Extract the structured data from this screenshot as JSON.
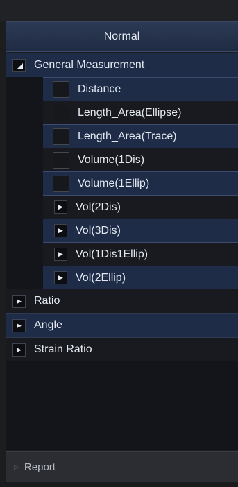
{
  "header": {
    "title": "Normal"
  },
  "tree": {
    "general": {
      "label": "General Measurement"
    },
    "items": [
      {
        "label": "Distance"
      },
      {
        "label": "Length_Area(Ellipse)"
      },
      {
        "label": "Length_Area(Trace)"
      },
      {
        "label": "Volume(1Dis)"
      },
      {
        "label": "Volume(1Ellip)"
      }
    ],
    "groups": [
      {
        "label": "Vol(2Dis)"
      },
      {
        "label": "Vol(3Dis)"
      },
      {
        "label": "Vol(1Dis1Ellip)"
      },
      {
        "label": "Vol(2Ellip)"
      }
    ],
    "top_groups": [
      {
        "label": "Ratio"
      },
      {
        "label": "Angle"
      },
      {
        "label": "Strain Ratio"
      }
    ]
  },
  "footer": {
    "label": "Report"
  },
  "icons": {
    "expanded": "triangle-down-icon",
    "collapsed": "triangle-right-icon",
    "checkbox": "checkbox-icon"
  },
  "colors": {
    "row_blue": "#1f2c48",
    "row_dark": "#181a1f",
    "header": "#26334d"
  }
}
